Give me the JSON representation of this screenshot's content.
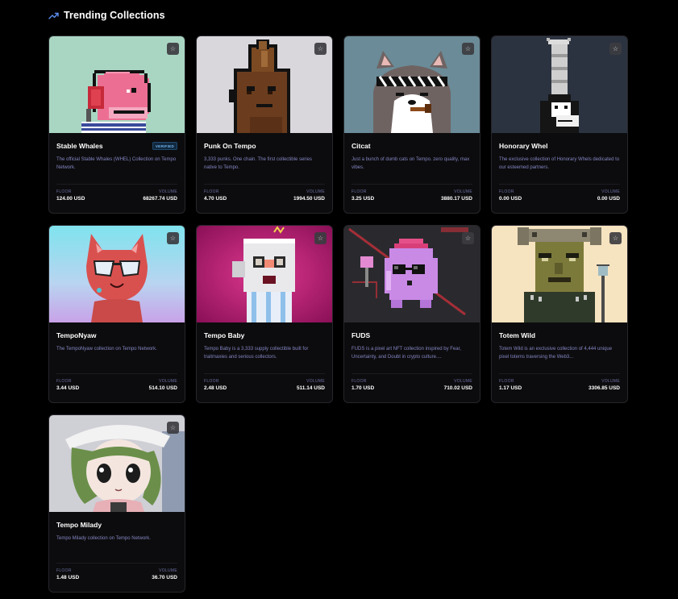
{
  "section": {
    "title": "Trending Collections",
    "icon": "trending-up-icon",
    "accent": "#5b8def"
  },
  "labels": {
    "floor": "FLOOR",
    "volume": "VOLUME",
    "verified": "VERIFIED",
    "favorite_icon": "star-icon"
  },
  "collections": [
    {
      "name": "Stable Whales",
      "verified": true,
      "description": "The official Stable Whales (WHEL) Collection on Tempo Network.",
      "floor": "124.00 USD",
      "volume": "68267.74 USD",
      "art": "pink-whale-art"
    },
    {
      "name": "Punk On Tempo",
      "verified": false,
      "description": "3,333 punks. One chain. The first collectible series native to Tempo.",
      "floor": "4.70 USD",
      "volume": "1994.50 USD",
      "art": "pixel-punk-art"
    },
    {
      "name": "Citcat",
      "verified": false,
      "description": "Just a bunch of dumb cats on Tempo. zero quality, max vibes.",
      "floor": "3.25 USD",
      "volume": "3880.17 USD",
      "art": "cat-with-headband-art"
    },
    {
      "name": "Honorary Whel",
      "verified": false,
      "description": "The exclusive collection of Honorary Whels dedicated to our esteemed partners.",
      "floor": "0.00 USD",
      "volume": "0.00 USD",
      "art": "tall-hat-whale-art"
    },
    {
      "name": "TempoNyaw",
      "verified": false,
      "description": "The TempoNyaw collection on Tempo Network.",
      "floor": "3.44 USD",
      "volume": "514.10 USD",
      "art": "red-cat-sunglasses-art"
    },
    {
      "name": "Tempo Baby",
      "verified": false,
      "description": "Tempo Baby is a 3,333 supply collectible built for traitmaxies and serious collectors.",
      "floor": "2.48 USD",
      "volume": "511.14 USD",
      "art": "voxel-baby-art"
    },
    {
      "name": "FUDS",
      "verified": false,
      "description": "FUDS is a pixel art NFT collection inspired by Fear, Uncertainty, and Doubt in crypto culture....",
      "floor": "1.70 USD",
      "volume": "710.02 USD",
      "art": "purple-blob-art"
    },
    {
      "name": "Totem Wild",
      "verified": false,
      "description": "Totem Wild is an exclusive collection of 4,444 unique pixel totems traversing the Web3...",
      "floor": "1.17 USD",
      "volume": "3306.85 USD",
      "art": "pixel-totem-art"
    },
    {
      "name": "Tempo Milady",
      "verified": false,
      "description": "Tempo Milady collection on Tempo Network.",
      "floor": "1.48 USD",
      "volume": "36.70 USD",
      "art": "milady-girl-art"
    }
  ]
}
